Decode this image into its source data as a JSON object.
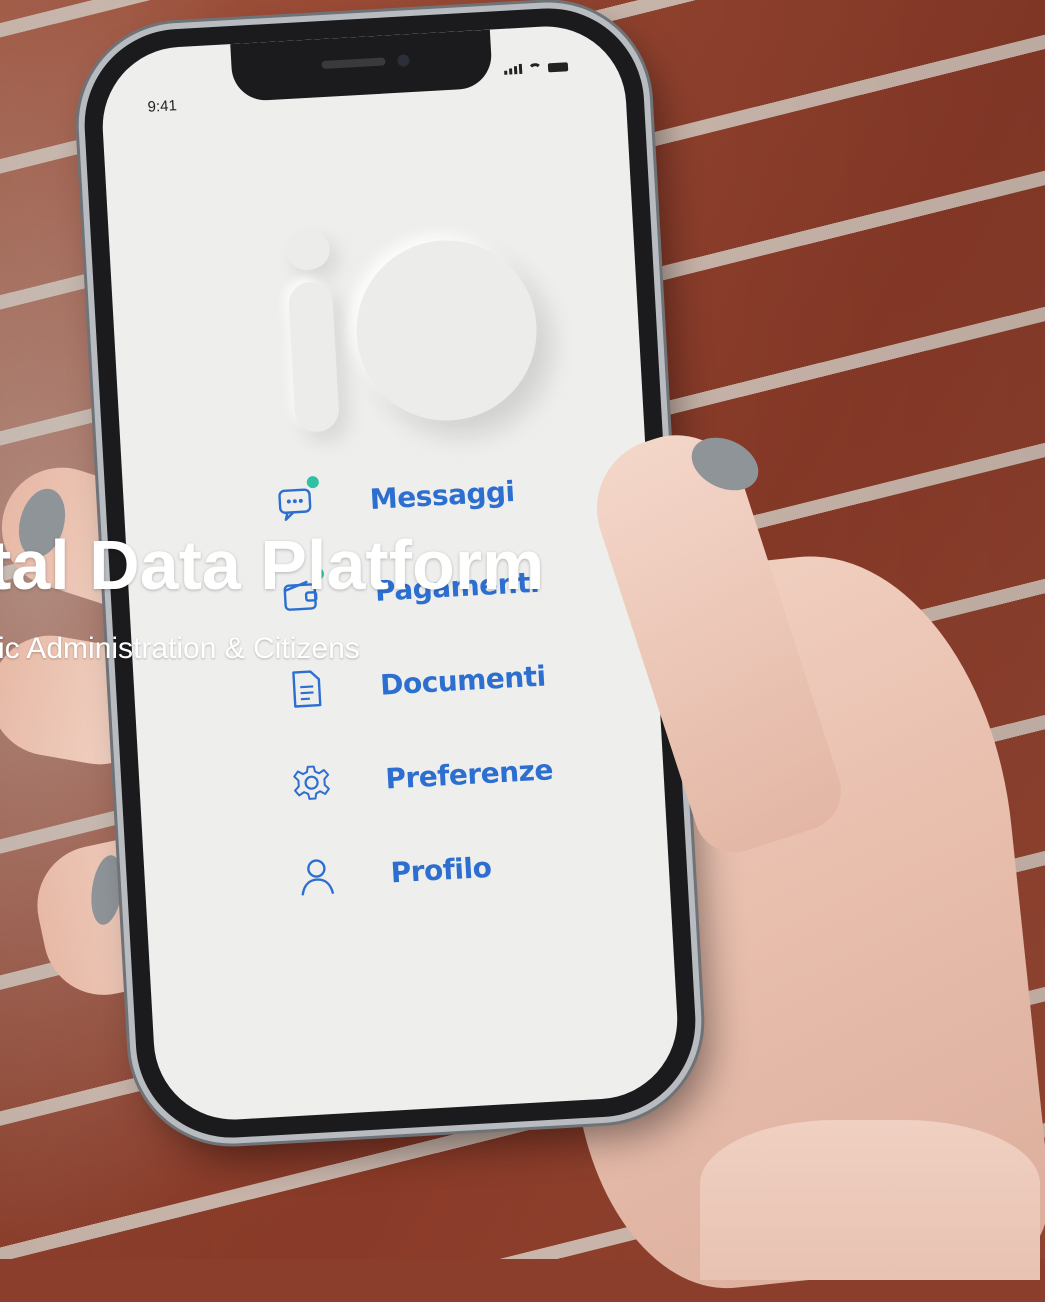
{
  "phone": {
    "status_time": "9:41"
  },
  "menu": {
    "items": [
      {
        "label": "Messaggi",
        "icon": "message-icon",
        "badge": true
      },
      {
        "label": "Pagamenti",
        "icon": "wallet-icon",
        "badge": true
      },
      {
        "label": "Documenti",
        "icon": "document-icon",
        "badge": false
      },
      {
        "label": "Preferenze",
        "icon": "gear-icon",
        "badge": false
      },
      {
        "label": "Profilo",
        "icon": "user-icon",
        "badge": false
      }
    ]
  },
  "overlay": {
    "title": "tal Data Platform",
    "subtitle": "ic Administration & Citizens"
  },
  "colors": {
    "menu_text": "#2d6fd0",
    "badge": "#2ec1a3",
    "screen_bg": "#eeeeec"
  }
}
